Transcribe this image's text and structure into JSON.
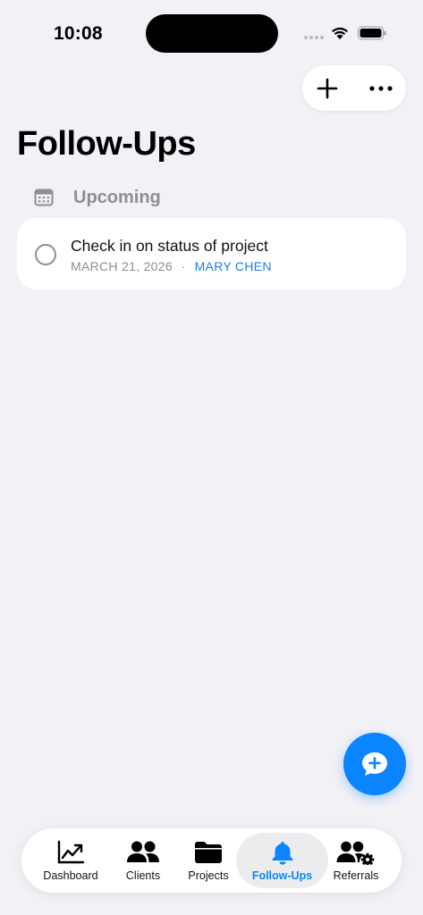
{
  "status_bar": {
    "time": "10:08"
  },
  "header": {
    "title": "Follow-Ups"
  },
  "section": {
    "label": "Upcoming"
  },
  "followups": [
    {
      "title": "Check in on status of project",
      "date": "MARCH 21, 2026",
      "separator": "·",
      "client": "MARY CHEN"
    }
  ],
  "tabs": [
    {
      "label": "Dashboard",
      "icon": "chart-line-icon"
    },
    {
      "label": "Clients",
      "icon": "people-icon"
    },
    {
      "label": "Projects",
      "icon": "folder-icon"
    },
    {
      "label": "Follow-Ups",
      "icon": "bell-icon",
      "active": true
    },
    {
      "label": "Referrals",
      "icon": "people-gear-icon"
    }
  ],
  "colors": {
    "accent": "#0a84ff",
    "background": "#f2f1f6",
    "secondary_text": "#8e8e93",
    "client_link": "#1c7ee8"
  }
}
